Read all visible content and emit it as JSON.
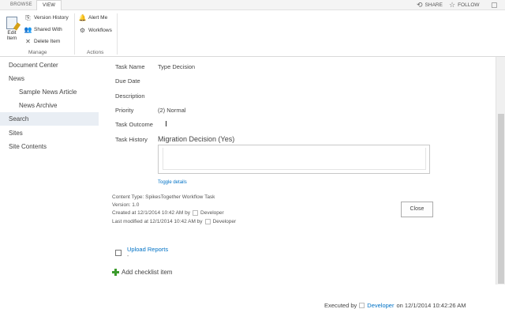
{
  "topbar": {
    "tabs": [
      "BROWSE",
      "VIEW"
    ],
    "share_label": "SHARE",
    "follow_label": "FOLLOW"
  },
  "ribbon": {
    "edit_item": [
      "Edit",
      "Item"
    ],
    "version_history": "Version History",
    "shared_with": "Shared With",
    "delete_item": "Delete Item",
    "alert_me": "Alert Me",
    "workflows": "Workflows",
    "group_manage": "Manage",
    "group_actions": "Actions"
  },
  "nav": {
    "items": [
      {
        "label": "Document Center"
      },
      {
        "label": "News"
      },
      {
        "label": "Sample News Article"
      },
      {
        "label": "News Archive"
      },
      {
        "label": "Search"
      },
      {
        "label": "Sites"
      },
      {
        "label": "Site Contents"
      }
    ]
  },
  "form": {
    "task_name_label": "Task Name",
    "task_name_value": "Type Decision",
    "due_date_label": "Due Date",
    "description_label": "Description",
    "priority_label": "Priority",
    "priority_value": "(2) Normal",
    "task_outcome_label": "Task Outcome",
    "task_history_label": "Task History",
    "history_title": "Migration Decision (Yes)",
    "executed_by_prefix": "Executed by",
    "executed_by_user": "Developer",
    "executed_on": "on 12/1/2014 10:42:26 AM",
    "toggle_details": "Toggle details"
  },
  "meta": {
    "content_type": "Content Type: SpikesTogether Workflow Task",
    "version": "Version: 1.0",
    "created": "Created at 12/1/2014 10:42 AM  by",
    "created_by": "Developer",
    "modified": "Last modified at 12/1/2014 10:42 AM  by",
    "modified_by": "Developer"
  },
  "buttons": {
    "close": "Close"
  },
  "checklist": {
    "item_label": "Upload Reports",
    "item_sub": "-",
    "add_label": "Add checklist item"
  },
  "icons": {
    "share": "share-icon",
    "follow": "star-icon"
  },
  "colors": {
    "link": "#0072c6",
    "selected_nav": "#e9eef4",
    "add_icon": "#3b9b2c"
  }
}
